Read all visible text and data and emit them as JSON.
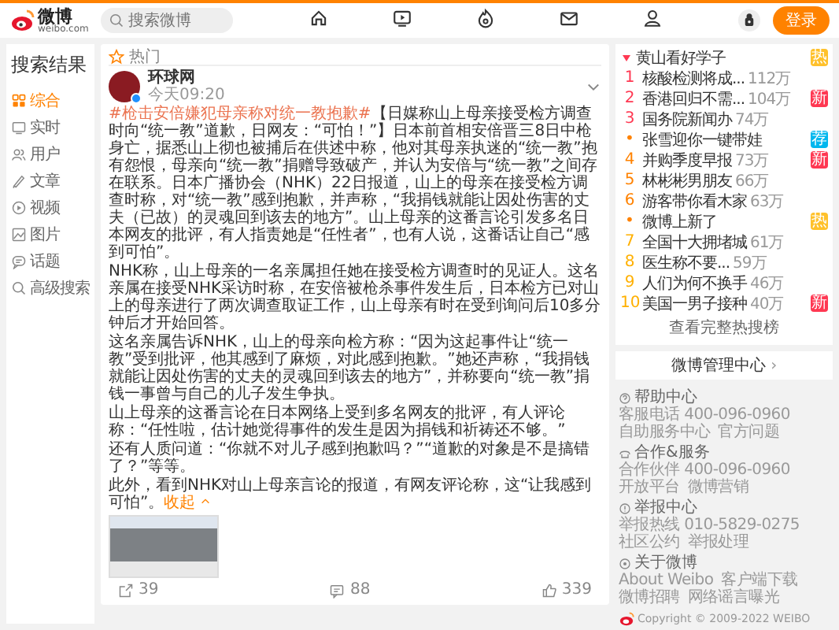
{
  "header": {
    "logo_text": "微博",
    "logo_subtext": "weibo.com",
    "search": {
      "placeholder": "搜索微博"
    },
    "nav_icons": [
      {
        "kind": "home"
      },
      {
        "kind": "video"
      },
      {
        "kind": "hot"
      },
      {
        "kind": "mail"
      },
      {
        "kind": "profile"
      }
    ],
    "login_button": "登录"
  },
  "sidebar": {
    "title": "搜索结果",
    "items": [
      {
        "label": "综合",
        "kind": "grid",
        "selected": true
      },
      {
        "label": "实时",
        "kind": "live",
        "selected": false
      },
      {
        "label": "用户",
        "kind": "user",
        "selected": false
      },
      {
        "label": "文章",
        "kind": "article",
        "selected": false
      },
      {
        "label": "视频",
        "kind": "video",
        "selected": false
      },
      {
        "label": "图片",
        "kind": "picture",
        "selected": false
      },
      {
        "label": "话题",
        "kind": "topic",
        "selected": false
      },
      {
        "label": "高级搜索",
        "kind": "search",
        "selected": false
      }
    ]
  },
  "post": {
    "section": "热门",
    "author": "环球网",
    "verified": true,
    "time": "今天09:20",
    "hashtag": "#枪击安倍嫌犯母亲称对统一教抱歉#",
    "paragraphs": [
      "【日媒称山上母亲接受检方调查时向“统一教”道歉，日网友：“可怕！”】日本前首相安倍晋三8日中枪身亡，据悉山上彻也被捕后在供述中称，他对其母亲执迷的“统一教”抱有怨恨，母亲向“统一教”捐赠导致破产，并认为安倍与“统一教”之间存在联系。日本广播协会（NHK）22日报道，山上的母亲在接受检方调查时称，对“统一教”感到抱歉，并声称，“我捐钱就能让因处伤害的丈夫（已故）的灵魂回到该去的地方”。山上母亲的这番言论引发多名日本网友的批评，有人指责她是“任性者”，也有人说，这番话让自己“感到可怕”。",
      "NHK称，山上母亲的一名亲属担任她在接受检方调查时的见证人。这名亲属在接受NHK采访时称，在安倍被枪杀事件发生后，日本检方已对山上的母亲进行了两次调查取证工作，山上母亲有时在受到询问后10多分钟后才开始回答。",
      "这名亲属告诉NHK，山上的母亲向检方称：“因为这起事件让“统一教”受到批评，他其感到了麻烦，对此感到抱歉。”她还声称，“我捐钱就能让因处伤害的丈夫的灵魂回到该去的地方”，并称要向“统一教”捐钱一事曾与自己的儿子发生争执。",
      "山上母亲的这番言论在日本网络上受到多名网友的批评，有人评论称：“任性啦，估计她觉得事件的发生是因为捐钱和祈祷还不够。”",
      "还有人质问道：“你就不对儿子感到抱歉吗？”“道歉的对象是不是搞错了？”等等。",
      "此外，看到NHK对山上母亲言论的报道，有网友评论称，这“让我感到可怕”。"
    ],
    "collapse_link": "收起",
    "actions": [
      {
        "kind": "repost",
        "count": "39"
      },
      {
        "kind": "comment",
        "count": "88"
      },
      {
        "kind": "like",
        "count": "339"
      }
    ]
  },
  "hot_search": {
    "items": [
      {
        "kind": "pinned",
        "title": "黄山看好学子",
        "badge": {
          "text": "热",
          "color": "#ffc12b"
        }
      },
      {
        "kind": "ranked",
        "rank": "1",
        "title": "核酸检测将成...",
        "heat": "112万"
      },
      {
        "kind": "ranked",
        "rank": "2",
        "title": "香港回归不需...",
        "heat": "104万",
        "badge": {
          "text": "新",
          "color": "#ff3852"
        }
      },
      {
        "kind": "ranked",
        "rank": "3",
        "title": "国务院新闻办",
        "heat": "74万"
      },
      {
        "kind": "promoted",
        "rank": "•",
        "title": "张雪迎你一键带娃",
        "badge": {
          "text": "荐",
          "color": "#00b7ee"
        }
      },
      {
        "kind": "ranked",
        "rank": "4",
        "title": "并购季度早报",
        "heat": "73万",
        "badge": {
          "text": "新",
          "color": "#ff3852"
        }
      },
      {
        "kind": "ranked",
        "rank": "5",
        "title": "林彬彬男朋友",
        "heat": "66万"
      },
      {
        "kind": "ranked",
        "rank": "6",
        "title": "游客带你看木家",
        "heat": "63万"
      },
      {
        "kind": "promoted",
        "rank": "•",
        "title": "微博上新了",
        "badge": {
          "text": "热",
          "color": "#ffc12b"
        }
      },
      {
        "kind": "ranked",
        "rank": "7",
        "title": "全国十大拥堵城",
        "heat": "61万"
      },
      {
        "kind": "ranked",
        "rank": "8",
        "title": "医生称不要...",
        "heat": "59万"
      },
      {
        "kind": "ranked",
        "rank": "9",
        "title": "人们为何不换手",
        "heat": "46万"
      },
      {
        "kind": "ranked",
        "rank": "10",
        "title": "美国一男子接种",
        "heat": "40万",
        "badge": {
          "text": "新",
          "color": "#ff3852"
        }
      }
    ],
    "more_link": "查看完整热搜榜"
  },
  "manage_center": {
    "label": "微博管理中心",
    "arrow": "›"
  },
  "footer": {
    "sections": [
      {
        "kind": "help",
        "title": "帮助中心",
        "links": [
          "客服电话 400-096-0960",
          "自助服务中心",
          "官方问题"
        ]
      },
      {
        "kind": "cooperation",
        "title": "合作&服务",
        "links": [
          "合作伙伴 400-096-0960",
          "开放平台",
          "微博营销"
        ]
      },
      {
        "kind": "report",
        "title": "举报中心",
        "links": [
          "举报热线 010-5829-0275",
          "社区公约",
          "举报处理"
        ]
      },
      {
        "kind": "about",
        "title": "关于微博",
        "links": [
          "About Weibo",
          "客户端下载",
          "微博招聘",
          "网络谣言曝光"
        ]
      }
    ],
    "copyright": "Copyright © 2009-2022 WEIBO"
  }
}
